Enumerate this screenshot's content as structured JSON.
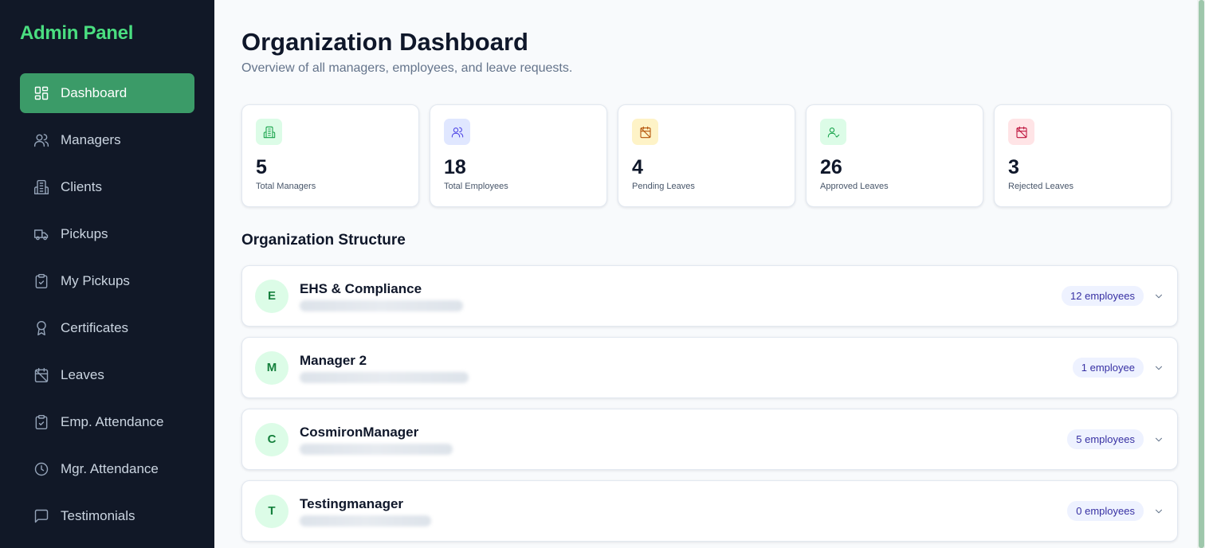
{
  "app": {
    "title": "Admin Panel"
  },
  "sidebar": {
    "items": [
      {
        "label": "Dashboard",
        "icon": "dashboard-icon",
        "active": true
      },
      {
        "label": "Managers",
        "icon": "users-icon"
      },
      {
        "label": "Clients",
        "icon": "building-icon"
      },
      {
        "label": "Pickups",
        "icon": "truck-icon"
      },
      {
        "label": "My Pickups",
        "icon": "clipboard-check-icon"
      },
      {
        "label": "Certificates",
        "icon": "award-icon"
      },
      {
        "label": "Leaves",
        "icon": "calendar-off-icon"
      },
      {
        "label": "Emp. Attendance",
        "icon": "clipboard-check-icon"
      },
      {
        "label": "Mgr. Attendance",
        "icon": "clock-icon"
      },
      {
        "label": "Testimonials",
        "icon": "message-square-icon"
      }
    ]
  },
  "header": {
    "title": "Organization Dashboard",
    "subtitle": "Overview of all managers, employees, and leave requests."
  },
  "stats": [
    {
      "value": "5",
      "label": "Total Managers",
      "icon": "building-icon",
      "color": "#16a34a",
      "bg": "#dcfce7"
    },
    {
      "value": "18",
      "label": "Total Employees",
      "icon": "users-icon",
      "color": "#4f46e5",
      "bg": "#e0e7ff"
    },
    {
      "value": "4",
      "label": "Pending Leaves",
      "icon": "calendar-off-icon",
      "color": "#b45309",
      "bg": "#fef3c7"
    },
    {
      "value": "26",
      "label": "Approved Leaves",
      "icon": "user-check-icon",
      "color": "#16a34a",
      "bg": "#dcfce7"
    },
    {
      "value": "3",
      "label": "Rejected Leaves",
      "icon": "calendar-off-icon",
      "color": "#be123c",
      "bg": "#ffe4e6"
    }
  ],
  "section": {
    "title": "Organization Structure"
  },
  "organizations": [
    {
      "initial": "E",
      "name": "EHS & Compliance",
      "badge": "12 employees"
    },
    {
      "initial": "M",
      "name": "Manager 2",
      "badge": "1 employee"
    },
    {
      "initial": "C",
      "name": "CosmironManager",
      "badge": "5 employees"
    },
    {
      "initial": "T",
      "name": "Testingmanager",
      "badge": "0 employees"
    }
  ],
  "colors": {
    "sidebar_bg": "#111827",
    "brand": "#4ade80",
    "active_nav": "#3b9b68",
    "badge_bg": "#eef2ff",
    "badge_text": "#3730a3"
  }
}
